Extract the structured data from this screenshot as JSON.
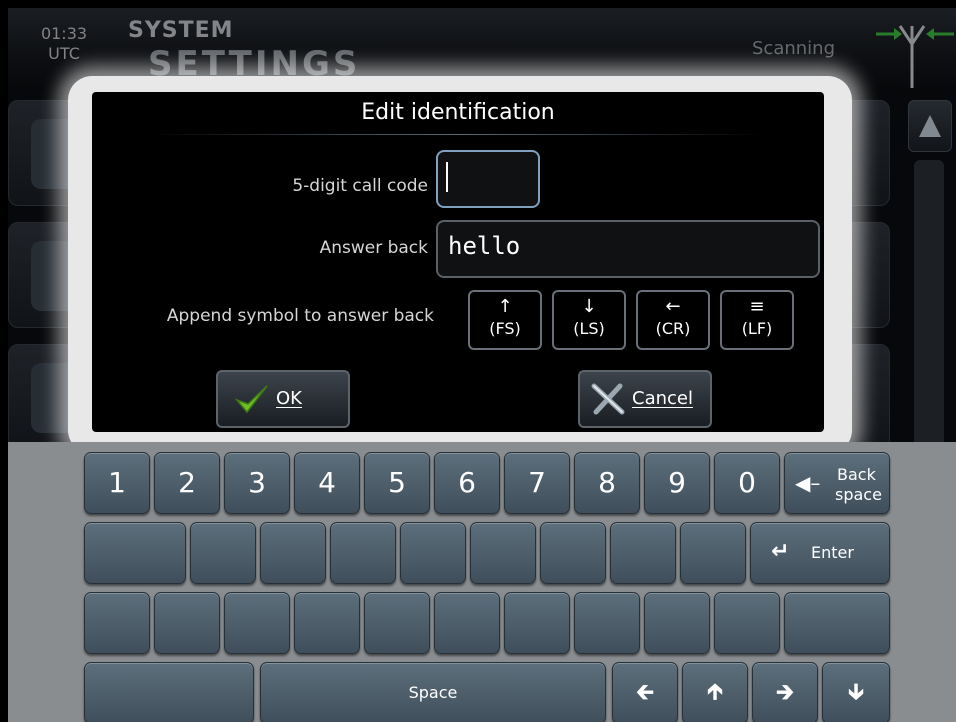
{
  "header": {
    "time": "01:33",
    "timezone": "UTC",
    "title_line1": "SYSTEM",
    "title_line2": "SETTINGS",
    "status": "Scanning"
  },
  "dialog": {
    "title": "Edit identification",
    "call_code_label": "5-digit call code",
    "call_code_value": "",
    "answer_back_label": "Answer back",
    "answer_back_value": "hello",
    "append_label": "Append symbol to answer back",
    "symbols": [
      {
        "glyph": "↑",
        "label": "(FS)"
      },
      {
        "glyph": "↓",
        "label": "(LS)"
      },
      {
        "glyph": "←",
        "label": "(CR)"
      },
      {
        "glyph": "≡",
        "label": "(LF)"
      }
    ],
    "ok_label": "OK",
    "cancel_label": "Cancel"
  },
  "keyboard": {
    "digits": [
      "1",
      "2",
      "3",
      "4",
      "5",
      "6",
      "7",
      "8",
      "9",
      "0"
    ],
    "backspace_line1": "Back",
    "backspace_line2": "space",
    "enter_label": "Enter",
    "space_label": "Space"
  },
  "colors": {
    "accent_green": "#6dbf2a",
    "key_face": "#4d5e6b",
    "field_active_border": "#7fa0bf"
  }
}
